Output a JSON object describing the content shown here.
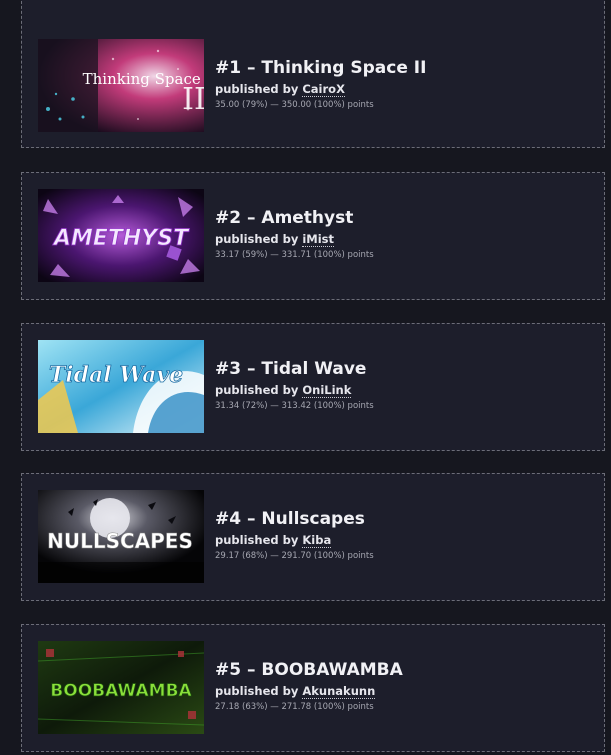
{
  "levels": [
    {
      "rank": "#1",
      "title": "#1 – Thinking Space II",
      "published_prefix": "published by",
      "creator": "CairoX",
      "points": "35.00 (79%) — 350.00 (100%) points",
      "thumbnail_icon": "thinking-space-thumbnail",
      "thumbnail_text": "Thinking Space II"
    },
    {
      "rank": "#2",
      "title": "#2 – Amethyst",
      "published_prefix": "published by",
      "creator": "iMist",
      "points": "33.17 (59%) — 331.71 (100%) points",
      "thumbnail_icon": "amethyst-thumbnail",
      "thumbnail_text": "AMETHYST"
    },
    {
      "rank": "#3",
      "title": "#3 – Tidal Wave",
      "published_prefix": "published by",
      "creator": "OniLink",
      "points": "31.34 (72%) — 313.42 (100%) points",
      "thumbnail_icon": "tidal-wave-thumbnail",
      "thumbnail_text": "Tidal Wave"
    },
    {
      "rank": "#4",
      "title": "#4 – Nullscapes",
      "published_prefix": "published by",
      "creator": "Kiba",
      "points": "29.17 (68%) — 291.70 (100%) points",
      "thumbnail_icon": "nullscapes-thumbnail",
      "thumbnail_text": "NULLSCAPES"
    },
    {
      "rank": "#5",
      "title": "#5 – BOOBAWAMBA",
      "published_prefix": "published by",
      "creator": "Akunakunn",
      "points": "27.18 (63%) — 271.78 (100%) points",
      "thumbnail_icon": "boobawamba-thumbnail",
      "thumbnail_text": "BOOBAWAMBA"
    }
  ]
}
